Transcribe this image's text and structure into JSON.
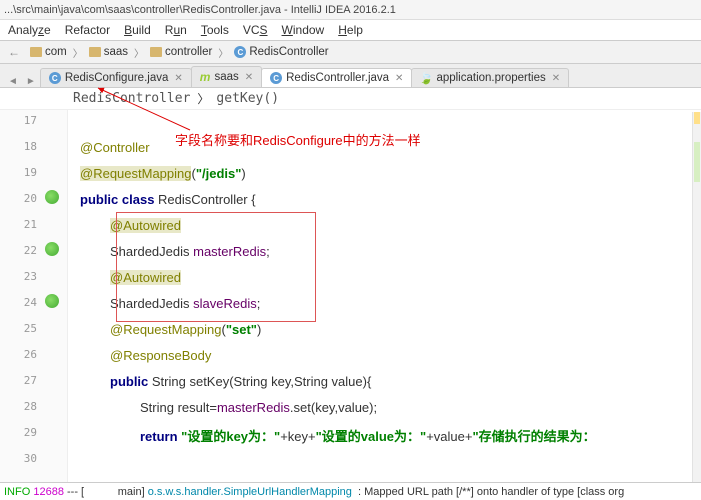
{
  "title_path": "...\\src\\main\\java\\com\\saas\\controller\\RedisController.java - IntelliJ IDEA 2016.2.1",
  "menu": {
    "analyze": "Analyze",
    "refactor": "Refactor",
    "build": "Build",
    "run": "Run",
    "tools": "Tools",
    "vcs": "VCS",
    "window": "Window",
    "help": "Help"
  },
  "nav": {
    "com": "com",
    "saas": "saas",
    "controller": "controller",
    "file": "RedisController"
  },
  "tabs": {
    "t1": "RedisConfigure.java",
    "t2": "saas",
    "t3": "RedisController.java",
    "t4": "application.properties"
  },
  "breadcrumb": {
    "class": "RedisController",
    "method": "getKey()"
  },
  "lines": {
    "l17": "17",
    "l18": "18",
    "l19": "19",
    "l20": "20",
    "l21": "21",
    "l22": "22",
    "l23": "23",
    "l24": "24",
    "l25": "25",
    "l26": "26",
    "l27": "27",
    "l28": "28",
    "l29": "29",
    "l30": "30"
  },
  "code": {
    "controller": "@Controller",
    "reqmap1a": "@RequestMapping",
    "reqmap1b": "(",
    "reqmap1c": "\"/jedis\"",
    "reqmap1d": ")",
    "pubclass1": "public class ",
    "pubclass2": "RedisController {",
    "auto1": "@Autowired",
    "f1a": "ShardedJedis ",
    "f1b": "masterRedis",
    "f1c": ";",
    "auto2": "@Autowired",
    "f2a": "ShardedJedis ",
    "f2b": "slaveRedis",
    "f2c": ";",
    "reqmap2a": "@RequestMapping",
    "reqmap2b": "(",
    "reqmap2c": "\"set\"",
    "reqmap2d": ")",
    "respbody": "@ResponseBody",
    "m1a": "public ",
    "m1b": "String setKey(String key,String value){",
    "m2a": "String result=",
    "m2b": "masterRedis",
    "m2c": ".set(key,value);",
    "m3a": "return ",
    "m3b": "\"设置的key为：\"",
    "m3c": "+key+",
    "m3d": "\"设置的value为：\"",
    "m3e": "+value+",
    "m3f": "\"存储执行的结果为："
  },
  "annotation": "字段名称要和RedisConfigure中的方法一样",
  "status": {
    "info": "INFO",
    "num": "12688",
    "dash": " --- [",
    "main": "           main] ",
    "handler": "o.s.w.s.handler.SimpleUrlHandlerMapping",
    "rest": "  : Mapped URL path [/**] onto handler of type [class org"
  }
}
